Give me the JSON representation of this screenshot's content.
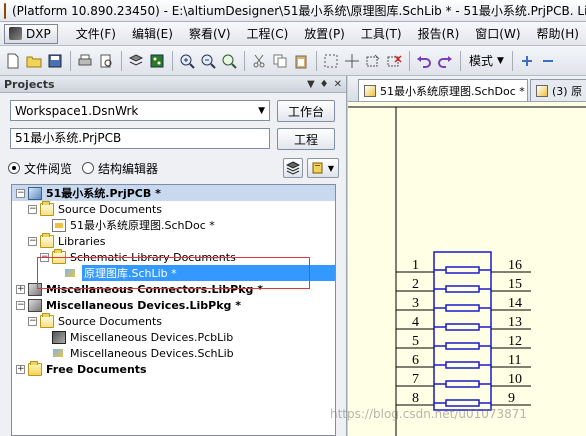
{
  "window": {
    "title": "(Platform 10.890.23450) - E:\\altiumDesigner\\51最小系统\\原理图库.SchLib * - 51最小系统.PrjPCB. Licen"
  },
  "menubar": {
    "dxp_label": "DXP",
    "items": [
      {
        "label": "文件(F)"
      },
      {
        "label": "编辑(E)"
      },
      {
        "label": "察看(V)"
      },
      {
        "label": "工程(C)"
      },
      {
        "label": "放置(P)"
      },
      {
        "label": "工具(T)"
      },
      {
        "label": "报告(R)"
      },
      {
        "label": "窗口(W)"
      },
      {
        "label": "帮助(H)"
      }
    ]
  },
  "toolbar": {
    "mode_label": "模式",
    "icons": [
      "new-doc-icon",
      "open-folder-icon",
      "save-icon",
      "print-icon",
      "print-preview-icon",
      "layers-icon",
      "pcb-icon",
      "zoom-in-icon",
      "zoom-out-icon",
      "zoom-fit-icon",
      "cut-icon",
      "copy-icon",
      "paste-icon",
      "select-area-icon",
      "move-icon",
      "select-icon",
      "deselect-icon",
      "undo-icon",
      "redo-icon",
      "add-icon",
      "minus-icon"
    ]
  },
  "projects_panel": {
    "title": "Projects",
    "workspace_value": "Workspace1.DsnWrk",
    "workspace_button": "工作台",
    "project_value": "51最小系统.PrjPCB",
    "project_button": "工程",
    "view_file": "文件阅览",
    "view_struct": "结构编辑器",
    "view_selected": "file"
  },
  "tree": [
    {
      "label": "51最小系统.PrjPCB *",
      "level": 0,
      "expander": "−",
      "icon": "pcbproj",
      "bold": true,
      "project_highlight": true
    },
    {
      "label": "Source Documents",
      "level": 1,
      "expander": "−",
      "icon": "folder-open"
    },
    {
      "label": "51最小系统原理图.SchDoc *",
      "level": 2,
      "expander": "",
      "icon": "doc-sch"
    },
    {
      "label": "Libraries",
      "level": 1,
      "expander": "−",
      "icon": "folder-open"
    },
    {
      "label": "Schematic Library Documents",
      "level": 2,
      "expander": "−",
      "icon": "folder-open"
    },
    {
      "label": "原理图库.SchLib *",
      "level": 3,
      "expander": "",
      "icon": "doc-lib",
      "selected": true
    },
    {
      "label": "Miscellaneous Connectors.LibPkg *",
      "level": 0,
      "expander": "+",
      "icon": "libpkg",
      "bold": true
    },
    {
      "label": "Miscellaneous Devices.LibPkg *",
      "level": 0,
      "expander": "−",
      "icon": "libpkg",
      "bold": true
    },
    {
      "label": "Source Documents",
      "level": 1,
      "expander": "−",
      "icon": "folder-open"
    },
    {
      "label": "Miscellaneous Devices.PcbLib",
      "level": 2,
      "expander": "",
      "icon": "pcblib"
    },
    {
      "label": "Miscellaneous Devices.SchLib",
      "level": 2,
      "expander": "",
      "icon": "doc-lib"
    },
    {
      "label": "Free Documents",
      "level": 0,
      "expander": "+",
      "icon": "folder",
      "bold": true
    }
  ],
  "tabs": {
    "active": "51最小系统原理图.SchDoc *",
    "inactive": "(3) 原"
  },
  "schematic": {
    "left_pins": [
      "1",
      "2",
      "3",
      "4",
      "5",
      "6",
      "7",
      "8"
    ],
    "right_pins": [
      "16",
      "15",
      "14",
      "13",
      "12",
      "11",
      "10",
      "9"
    ],
    "colors": {
      "body": "#1a1acc",
      "canvas": "#ffffe5",
      "wire": "#000000",
      "highlight_box": "#e0353a",
      "selection": "#3399ff"
    }
  },
  "watermark": "https://blog.csdn.net/u01073871"
}
